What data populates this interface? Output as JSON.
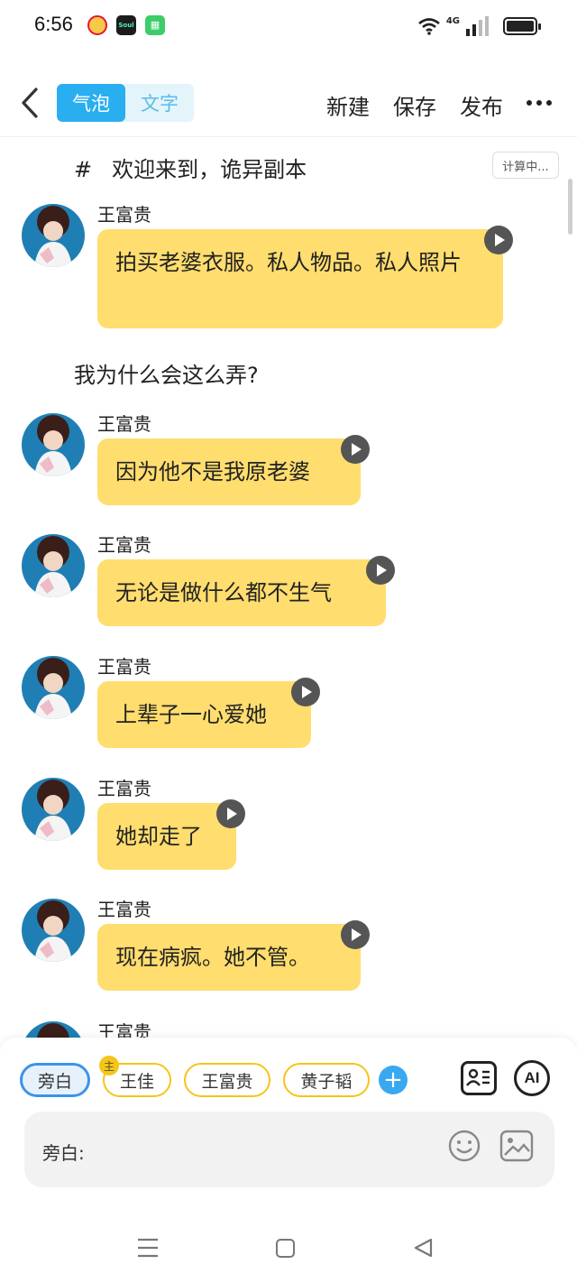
{
  "status_bar": {
    "time": "6:56",
    "network": "4G"
  },
  "toolbar": {
    "segments": [
      "气泡",
      "文字"
    ],
    "active_segment": "气泡",
    "new_label": "新建",
    "save_label": "保存",
    "publish_label": "发布"
  },
  "chat": {
    "heading_hash": "#",
    "heading": "欢迎来到，诡异副本",
    "calc_badge": "计算中...",
    "messages": [
      {
        "sender": "王富贵",
        "text": "拍买老婆衣服。私人物品。私人照片"
      },
      {
        "sender": "王富贵",
        "text": "因为他不是我原老婆"
      },
      {
        "sender": "王富贵",
        "text": "无论是做什么都不生气"
      },
      {
        "sender": "王富贵",
        "text": "上辈子一心爱她"
      },
      {
        "sender": "王富贵",
        "text": "她却走了"
      },
      {
        "sender": "王富贵",
        "text": "现在病疯。她不管。"
      },
      {
        "sender": "王富贵",
        "text": ""
      }
    ],
    "narration": "我为什么会这么弄?"
  },
  "composer": {
    "roles": [
      "旁白",
      "王佳",
      "王富贵",
      "黄子韬"
    ],
    "main_badge": "主",
    "active_role": "旁白",
    "ai_label": "AI",
    "input_label": "旁白:"
  },
  "colors": {
    "accent": "#29aef0",
    "bubble": "#ffdd6e",
    "chip_border": "#f5c518",
    "active_chip_border": "#3d93e8"
  },
  "icons": [
    "back-icon",
    "more-icon",
    "play-icon",
    "add-icon",
    "character-card-icon",
    "emoji-icon",
    "image-icon",
    "menu-icon",
    "home-icon",
    "nav-back-icon",
    "wifi-icon",
    "signal-icon",
    "battery-icon"
  ]
}
